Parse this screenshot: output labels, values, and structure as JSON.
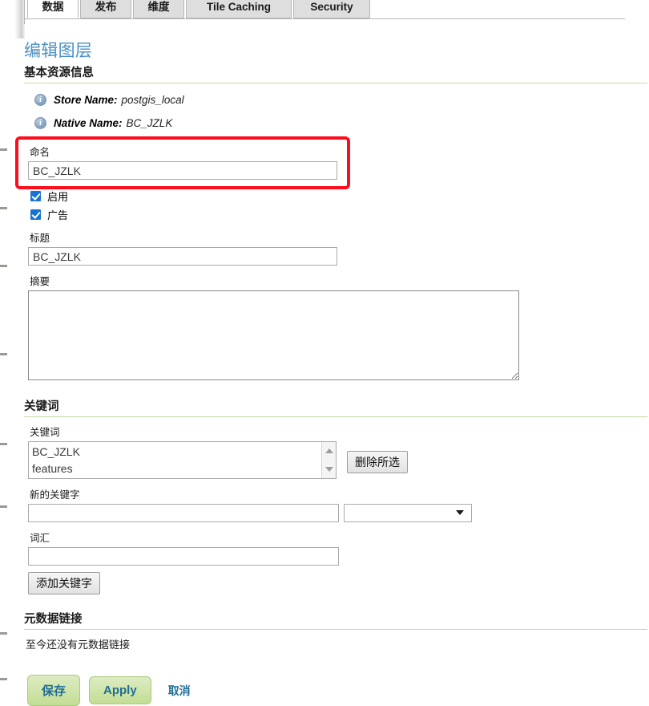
{
  "tabs": [
    {
      "label": "数据",
      "active": true
    },
    {
      "label": "发布",
      "active": false
    },
    {
      "label": "维度",
      "active": false
    },
    {
      "label": "Tile Caching",
      "active": false
    },
    {
      "label": "Security",
      "active": false
    }
  ],
  "page": {
    "title": "编辑图层",
    "title_color": "#4a90c4"
  },
  "basic_resource": {
    "heading": "基本资源信息",
    "store": {
      "icon": "info-icon",
      "label": "Store Name:",
      "value": "postgis_local"
    },
    "native": {
      "icon": "info-icon",
      "label": "Native Name:",
      "value": "BC_JZLK"
    },
    "name_field": {
      "label": "命名",
      "value": "BC_JZLK"
    },
    "enabled_checkbox": {
      "label": "启用",
      "checked": true
    },
    "advertised_checkbox": {
      "label": "广告",
      "checked": true
    },
    "title_field": {
      "label": "标题",
      "value": "BC_JZLK"
    },
    "abstract_field": {
      "label": "摘要",
      "value": ""
    }
  },
  "keywords": {
    "heading": "关键词",
    "list_label": "关键词",
    "items": [
      "BC_JZLK",
      "features"
    ],
    "remove_button": "删除所选",
    "new_keyword_label": "新的关键字",
    "new_keyword_value": "",
    "language_select_value": "",
    "vocabulary_label": "词汇",
    "vocabulary_value": "",
    "add_button": "添加关键字"
  },
  "metadata_links": {
    "heading": "元数据链接",
    "empty_text": "至今还没有元数据链接"
  },
  "actions": {
    "save": "保存",
    "apply": "Apply",
    "cancel": "取消",
    "button_color": "#c2dd93",
    "link_color": "#1f6d94"
  },
  "annotation": {
    "highlight_color": "#fc0d1b",
    "target": "命名"
  }
}
